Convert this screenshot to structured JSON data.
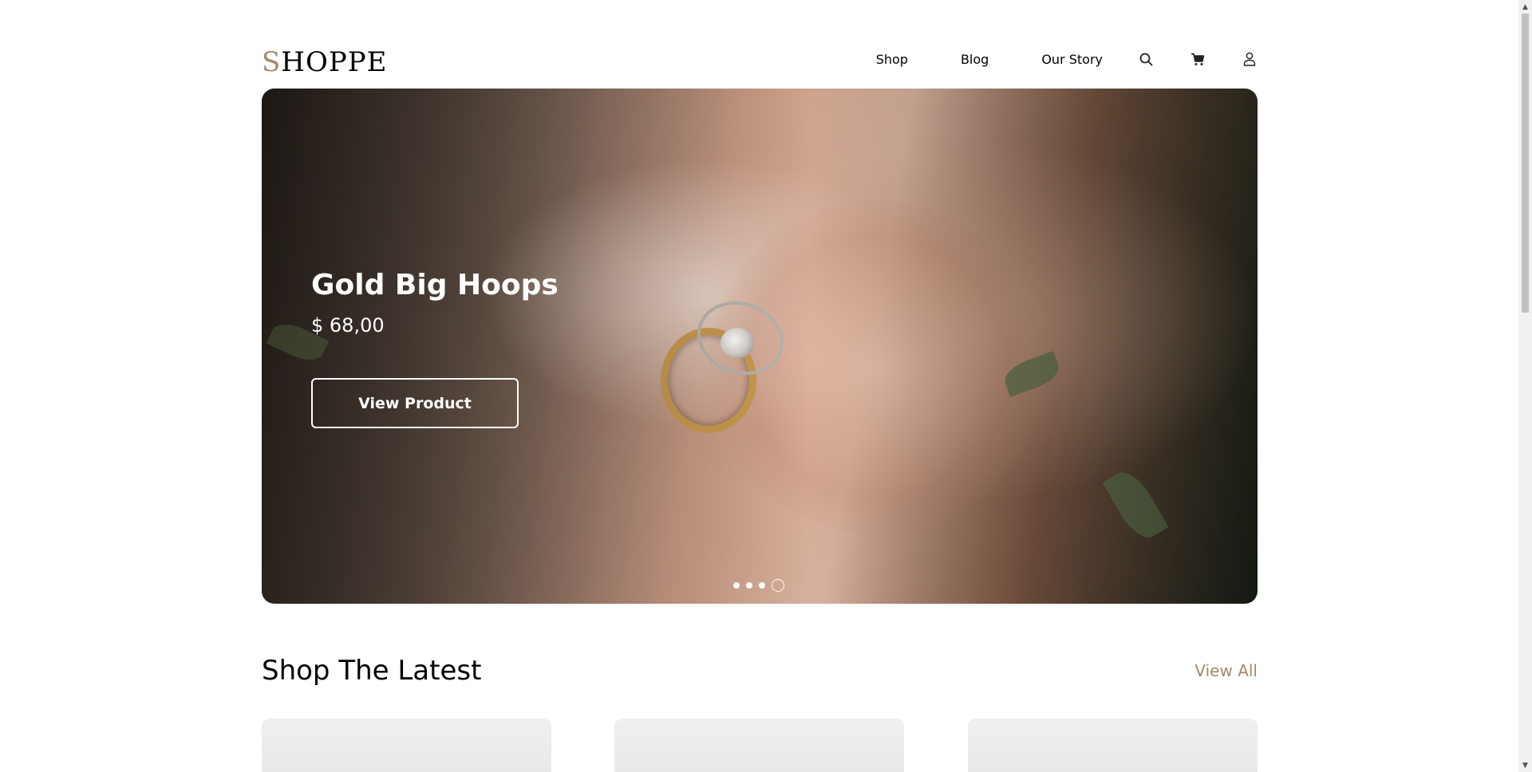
{
  "header": {
    "logo_first": "S",
    "logo_rest": "HOPPE",
    "nav": {
      "shop": "Shop",
      "blog": "Blog",
      "our_story": "Our Story"
    },
    "icons": [
      "search-icon",
      "cart-icon",
      "user-icon"
    ]
  },
  "hero": {
    "title": "Gold Big Hoops",
    "price": "$ 68,00",
    "button_label": "View Product",
    "slides_count": 4,
    "active_slide": 4
  },
  "latest": {
    "title": "Shop The Latest",
    "view_all": "View All",
    "cards_count": 3
  },
  "colors": {
    "accent": "#a18a68",
    "text": "#000000",
    "background": "#ffffff"
  }
}
